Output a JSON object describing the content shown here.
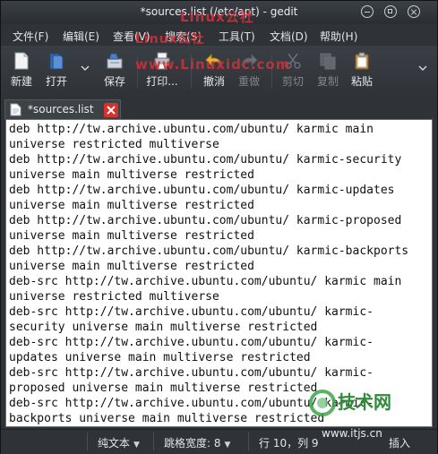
{
  "window": {
    "title": "*sources.list (/etc/apt) - gedit"
  },
  "menubar": {
    "items": [
      "文件(F)",
      "编辑(E)",
      "查看(V)",
      "搜索(S)",
      "工具(T)",
      "文档(D)",
      "帮助(H)"
    ]
  },
  "toolbar": {
    "new_label": "新建",
    "open_label": "打开",
    "save_label": "保存",
    "print_label": "打印...",
    "undo_label": "撤消",
    "redo_label": "重做",
    "cut_label": "剪切",
    "copy_label": "复制",
    "paste_label": "粘贴"
  },
  "watermark": {
    "line1": "Linux公社",
    "line2": "Linux公社",
    "line3": "www.Linuxidc.com"
  },
  "tabs": [
    {
      "label": "*sources.list"
    }
  ],
  "editor": {
    "lines": [
      "deb http://tw.archive.ubuntu.com/ubuntu/ karmic main",
      "universe restricted multiverse",
      "deb http://tw.archive.ubuntu.com/ubuntu/ karmic-security",
      "universe main multiverse restricted",
      "deb http://tw.archive.ubuntu.com/ubuntu/ karmic-updates",
      "universe main multiverse restricted",
      "deb http://tw.archive.ubuntu.com/ubuntu/ karmic-proposed",
      "universe main multiverse restricted",
      "deb http://tw.archive.ubuntu.com/ubuntu/ karmic-backports",
      "universe main multiverse restricted",
      "deb-src http://tw.archive.ubuntu.com/ubuntu/ karmic main",
      "universe restricted multiverse",
      "deb-src http://tw.archive.ubuntu.com/ubuntu/ karmic-",
      "security universe main multiverse restricted",
      "deb-src http://tw.archive.ubuntu.com/ubuntu/ karmic-",
      "updates universe main multiverse restricted",
      "deb-src http://tw.archive.ubuntu.com/ubuntu/ karmic-",
      "proposed universe main multiverse restricted",
      "deb-src http://tw.archive.ubuntu.com/ubuntu/ karmic-",
      "backports universe main multiverse restricted"
    ]
  },
  "statusbar": {
    "language": "纯文本",
    "tab_width": "跳格宽度: 8",
    "position": "行 10，列 9",
    "mode": "插入"
  },
  "brand": {
    "name": "技术网",
    "url": "www.itjs.cn"
  },
  "colors": {
    "accent_watermark": "#d0303a",
    "close_tab": "#d8302a",
    "brand_green": "#2f8a3a"
  }
}
